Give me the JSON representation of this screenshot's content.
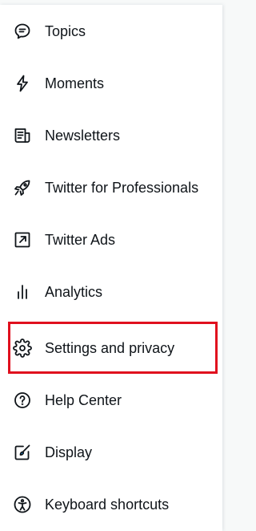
{
  "menu": {
    "items": [
      {
        "label": "Topics",
        "icon": "topics-icon"
      },
      {
        "label": "Moments",
        "icon": "lightning-icon"
      },
      {
        "label": "Newsletters",
        "icon": "newsletter-icon"
      },
      {
        "label": "Twitter for Professionals",
        "icon": "rocket-icon"
      },
      {
        "label": "Twitter Ads",
        "icon": "external-link-icon"
      },
      {
        "label": "Analytics",
        "icon": "bar-chart-icon"
      },
      {
        "label": "Settings and privacy",
        "icon": "gear-icon"
      },
      {
        "label": "Help Center",
        "icon": "help-icon"
      },
      {
        "label": "Display",
        "icon": "display-icon"
      },
      {
        "label": "Keyboard shortcuts",
        "icon": "accessibility-icon"
      }
    ],
    "highlighted_item": "Settings and privacy"
  },
  "colors": {
    "text": "#0f1419",
    "highlight_border": "#e0101e",
    "panel_background": "#ffffff",
    "page_background": "#f7f9f9"
  }
}
